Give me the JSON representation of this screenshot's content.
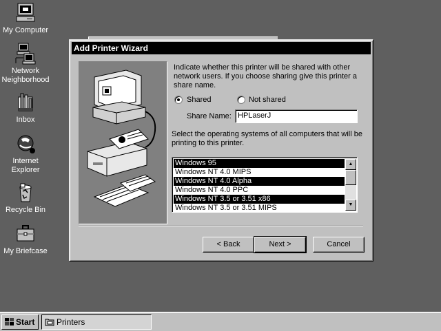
{
  "desktop": {
    "icons": [
      {
        "label_lines": [
          "My Computer"
        ],
        "icon": "my-computer-icon"
      },
      {
        "label_lines": [
          "Network",
          "Neighborhood"
        ],
        "icon": "network-neighborhood-icon"
      },
      {
        "label_lines": [
          "Inbox"
        ],
        "icon": "inbox-icon"
      },
      {
        "label_lines": [
          "Internet",
          "Explorer"
        ],
        "icon": "internet-explorer-icon"
      },
      {
        "label_lines": [
          "Recycle Bin"
        ],
        "icon": "recycle-bin-icon"
      },
      {
        "label_lines": [
          "My Briefcase"
        ],
        "icon": "briefcase-icon"
      }
    ]
  },
  "dialog": {
    "title": "Add Printer Wizard",
    "intro_line1": "Indicate whether this printer will be shared with other",
    "intro_line2": "network users.  If you choose sharing give this printer a",
    "intro_line3": "share name.",
    "shared_label": "Shared",
    "not_shared_label": "Not shared",
    "selected_option": "Shared",
    "share_name_label": "Share Name:",
    "share_name_value": "HPLaserJ",
    "os_line1": "Select the operating systems of all computers that will be",
    "os_line2": "printing to this printer.",
    "os_list": [
      {
        "label": "Windows 95",
        "selected": true
      },
      {
        "label": "Windows NT 4.0 MIPS",
        "selected": false
      },
      {
        "label": "Windows NT 4.0 Alpha",
        "selected": true
      },
      {
        "label": "Windows NT 4.0 PPC",
        "selected": false
      },
      {
        "label": "Windows NT 3.5 or 3.51 x86",
        "selected": true
      },
      {
        "label": "Windows NT 3.5 or 3.51 MIPS",
        "selected": false
      }
    ],
    "back_label": "< Back",
    "next_label": "Next >",
    "cancel_label": "Cancel"
  },
  "taskbar": {
    "start_label": "Start",
    "task_label": "Printers"
  }
}
